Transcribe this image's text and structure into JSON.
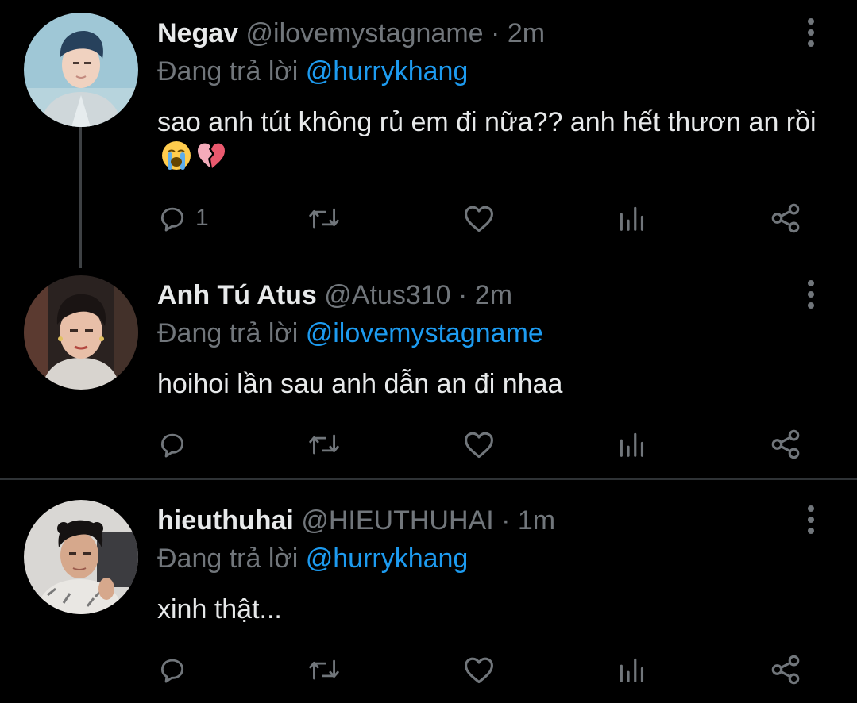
{
  "colors": {
    "background": "#000000",
    "text": "#e7e9ea",
    "muted": "#71767b",
    "link": "#1d9bf0",
    "divider": "#2f3336"
  },
  "replies": [
    {
      "display_name": "Negav",
      "handle": "@ilovemystagname",
      "separator": "·",
      "time": "2m",
      "replying_prefix": "Đang trả lời",
      "replying_to": "@hurrykhang",
      "text": "sao anh tút không rủ em đi nữa?? anh hết thươn an rồi",
      "emojis": [
        "loudly-crying-face",
        "broken-heart"
      ],
      "reply_count": "1",
      "icons": [
        "reply-icon",
        "retweet-icon",
        "like-icon",
        "analytics-icon",
        "share-icon",
        "more-icon"
      ]
    },
    {
      "display_name": "Anh Tú Atus",
      "handle": "@Atus310",
      "separator": "·",
      "time": "2m",
      "replying_prefix": "Đang trả lời",
      "replying_to": "@ilovemystagname",
      "text": "hoihoi lần sau anh dẫn an đi nhaa",
      "reply_count": "",
      "icons": [
        "reply-icon",
        "retweet-icon",
        "like-icon",
        "analytics-icon",
        "share-icon",
        "more-icon"
      ]
    },
    {
      "display_name": "hieuthuhai",
      "handle": "@HIEUTHUHAI",
      "separator": "·",
      "time": "1m",
      "replying_prefix": "Đang trả lời",
      "replying_to": "@hurrykhang",
      "text": "xinh thật...",
      "reply_count": "",
      "icons": [
        "reply-icon",
        "retweet-icon",
        "like-icon",
        "analytics-icon",
        "share-icon",
        "more-icon"
      ]
    }
  ]
}
